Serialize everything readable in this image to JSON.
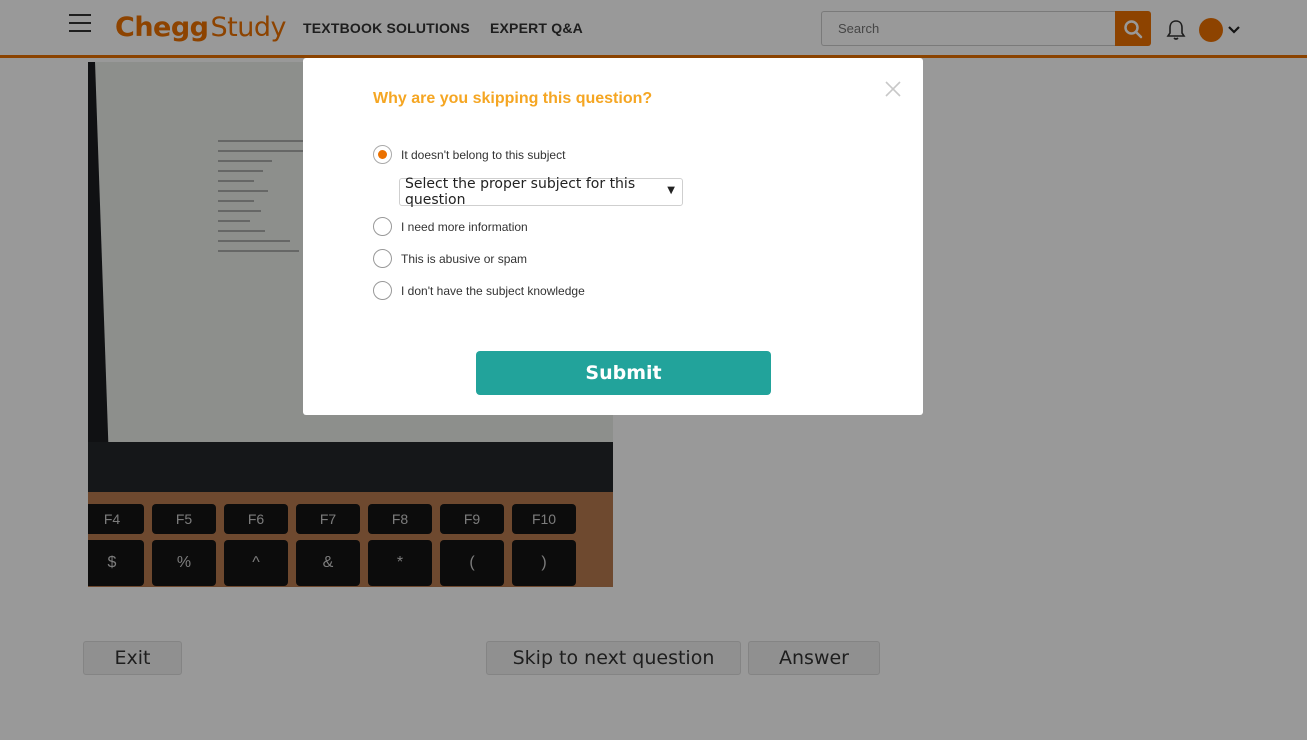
{
  "header": {
    "logo_brand": "Chegg",
    "logo_product": "Study",
    "nav": [
      "TEXTBOOK SOLUTIONS",
      "EXPERT Q&A"
    ],
    "search_placeholder": "Search",
    "accent_color": "#eb7100"
  },
  "background": {
    "function_keys": [
      "F4",
      "F5",
      "F6",
      "F7",
      "F8",
      "F9",
      "F10"
    ],
    "symbol_keys": [
      "$",
      "%",
      "^",
      "&",
      "*",
      "(",
      ")"
    ],
    "buttons": {
      "exit": "Exit",
      "skip": "Skip to next question",
      "answer": "Answer"
    }
  },
  "modal": {
    "title": "Why are you skipping this question?",
    "options": [
      {
        "label": "It doesn't belong to this subject",
        "selected": true
      },
      {
        "label": "I need more information",
        "selected": false
      },
      {
        "label": "This is abusive or spam",
        "selected": false
      },
      {
        "label": "I don't have the subject knowledge",
        "selected": false
      }
    ],
    "subject_select_value": "Select the proper subject for this question",
    "submit_label": "Submit",
    "title_color": "#f5a623",
    "submit_color": "#22a39b"
  }
}
